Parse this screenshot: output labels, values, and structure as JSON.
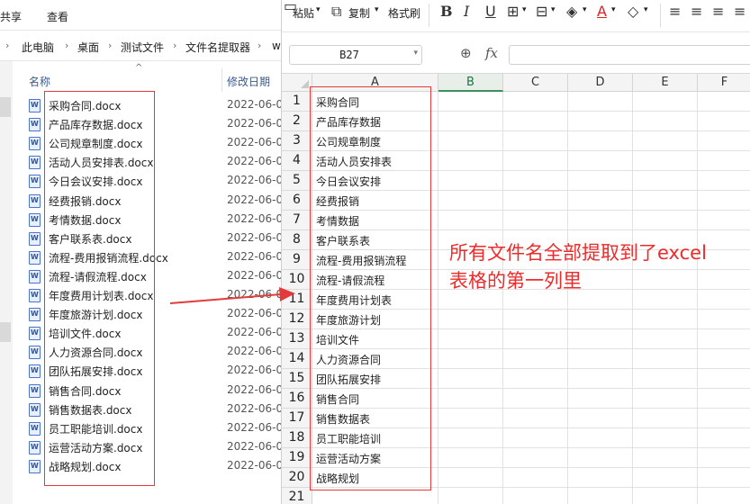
{
  "explorer": {
    "ribbon": {
      "share": "共享",
      "view": "查看"
    },
    "breadcrumb": [
      "此电脑",
      "桌面",
      "测试文件",
      "文件名提取器",
      "w"
    ],
    "columns": {
      "name": "名称",
      "modified": "修改日期"
    },
    "files": [
      {
        "name": "采购合同.docx",
        "date": "2022-06-0"
      },
      {
        "name": "产品库存数据.docx",
        "date": "2022-06-0"
      },
      {
        "name": "公司规章制度.docx",
        "date": "2022-06-0"
      },
      {
        "name": "活动人员安排表.docx",
        "date": "2022-06-0"
      },
      {
        "name": "今日会议安排.docx",
        "date": "2022-06-0"
      },
      {
        "name": "经费报销.docx",
        "date": "2022-06-0"
      },
      {
        "name": "考情数据.docx",
        "date": "2022-06-0"
      },
      {
        "name": "客户联系表.docx",
        "date": "2022-06-0"
      },
      {
        "name": "流程-费用报销流程.docx",
        "date": "2022-06-0"
      },
      {
        "name": "流程-请假流程.docx",
        "date": "2022-06-0"
      },
      {
        "name": "年度费用计划表.docx",
        "date": "2022-06-0"
      },
      {
        "name": "年度旅游计划.docx",
        "date": "2022-06-0"
      },
      {
        "name": "培训文件.docx",
        "date": "2022-06-0"
      },
      {
        "name": "人力资源合同.docx",
        "date": "2022-06-0"
      },
      {
        "name": "团队拓展安排.docx",
        "date": "2022-06-0"
      },
      {
        "name": "销售合同.docx",
        "date": "2022-06-0"
      },
      {
        "name": "销售数据表.docx",
        "date": "2022-06-0"
      },
      {
        "name": "员工职能培训.docx",
        "date": "2022-06-0"
      },
      {
        "name": "运营活动方案.docx",
        "date": "2022-06-0"
      },
      {
        "name": "战略规划.docx",
        "date": "2022-06-0"
      }
    ]
  },
  "toolbar": {
    "paste": "粘贴",
    "copy": "复制",
    "format_painter": "格式刷",
    "bold": "B",
    "italic": "I",
    "underline": "U",
    "font_color_letter": "A"
  },
  "formula_bar": {
    "cell_ref": "B27",
    "fx": "fx"
  },
  "sheet": {
    "columns": [
      "A",
      "B",
      "C",
      "D",
      "E",
      "F"
    ],
    "active_column": "B",
    "rows": [
      "1",
      "2",
      "3",
      "4",
      "5",
      "6",
      "7",
      "8",
      "9",
      "10",
      "11",
      "12",
      "13",
      "14",
      "15",
      "16",
      "17",
      "18",
      "19",
      "20",
      "21"
    ],
    "column_a": [
      "采购合同",
      "产品库存数据",
      "公司规章制度",
      "活动人员安排表",
      "今日会议安排",
      "经费报销",
      "考情数据",
      "客户联系表",
      "流程-费用报销流程",
      "流程-请假流程",
      "年度费用计划表",
      "年度旅游计划",
      "培训文件",
      "人力资源合同",
      "团队拓展安排",
      "销售合同",
      "销售数据表",
      "员工职能培训",
      "运营活动方案",
      "战略规划",
      ""
    ]
  },
  "annotation": {
    "line1": "所有文件名全部提取到了excel",
    "line2": "表格的第一列里",
    "color": "#ee2b2b"
  }
}
